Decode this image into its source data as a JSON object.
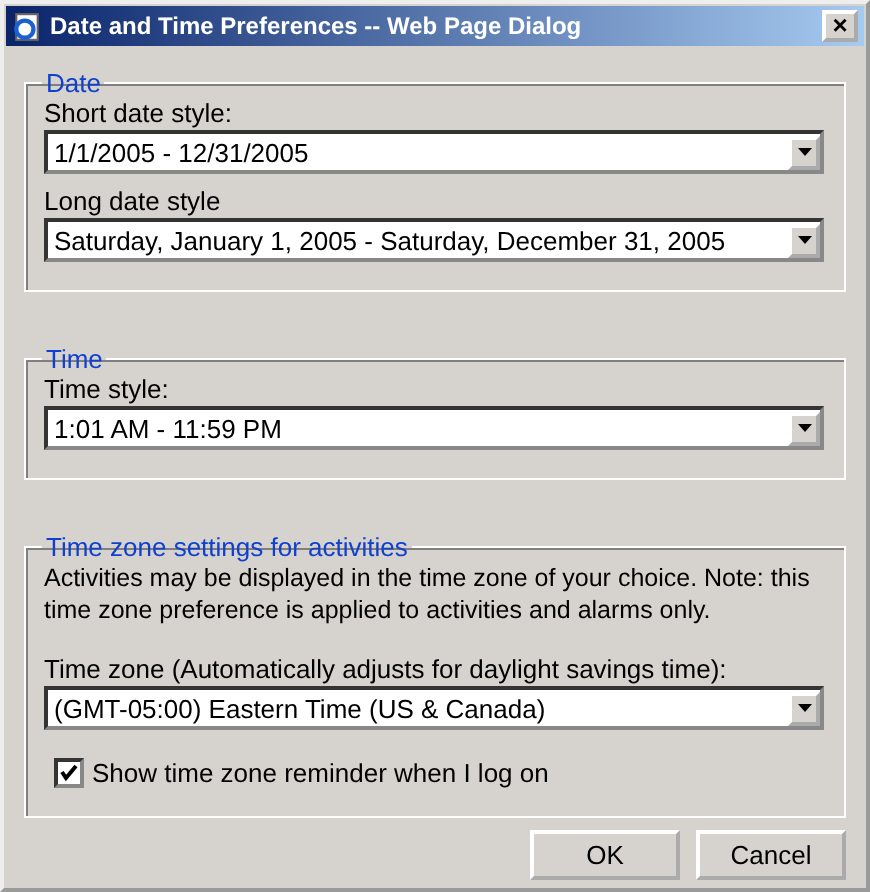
{
  "window": {
    "title": "Date and Time Preferences -- Web Page Dialog",
    "close": "×"
  },
  "groups": [
    {
      "legend": "Date",
      "fields": [
        {
          "label": "Short date style:",
          "value": "1/1/2005 - 12/31/2005"
        },
        {
          "label": "Long date style",
          "value": "Saturday, January 1, 2005 - Saturday, December 31, 2005"
        }
      ]
    },
    {
      "legend": "Time",
      "fields": [
        {
          "label": "Time style:",
          "value": "1:01 AM - 11:59 PM"
        }
      ]
    },
    {
      "legend": "Time zone settings for activities",
      "note": "Activities may be displayed in the time zone of your choice. Note: this time zone preference is applied to activities and alarms only.",
      "fields": [
        {
          "label": "Time zone (Automatically adjusts for daylight savings time):",
          "value": "(GMT-05:00) Eastern Time (US & Canada)"
        }
      ],
      "checkbox": {
        "label": "Show time zone reminder when I log on",
        "checked": true
      }
    }
  ],
  "buttons": [
    "OK",
    "Cancel"
  ]
}
